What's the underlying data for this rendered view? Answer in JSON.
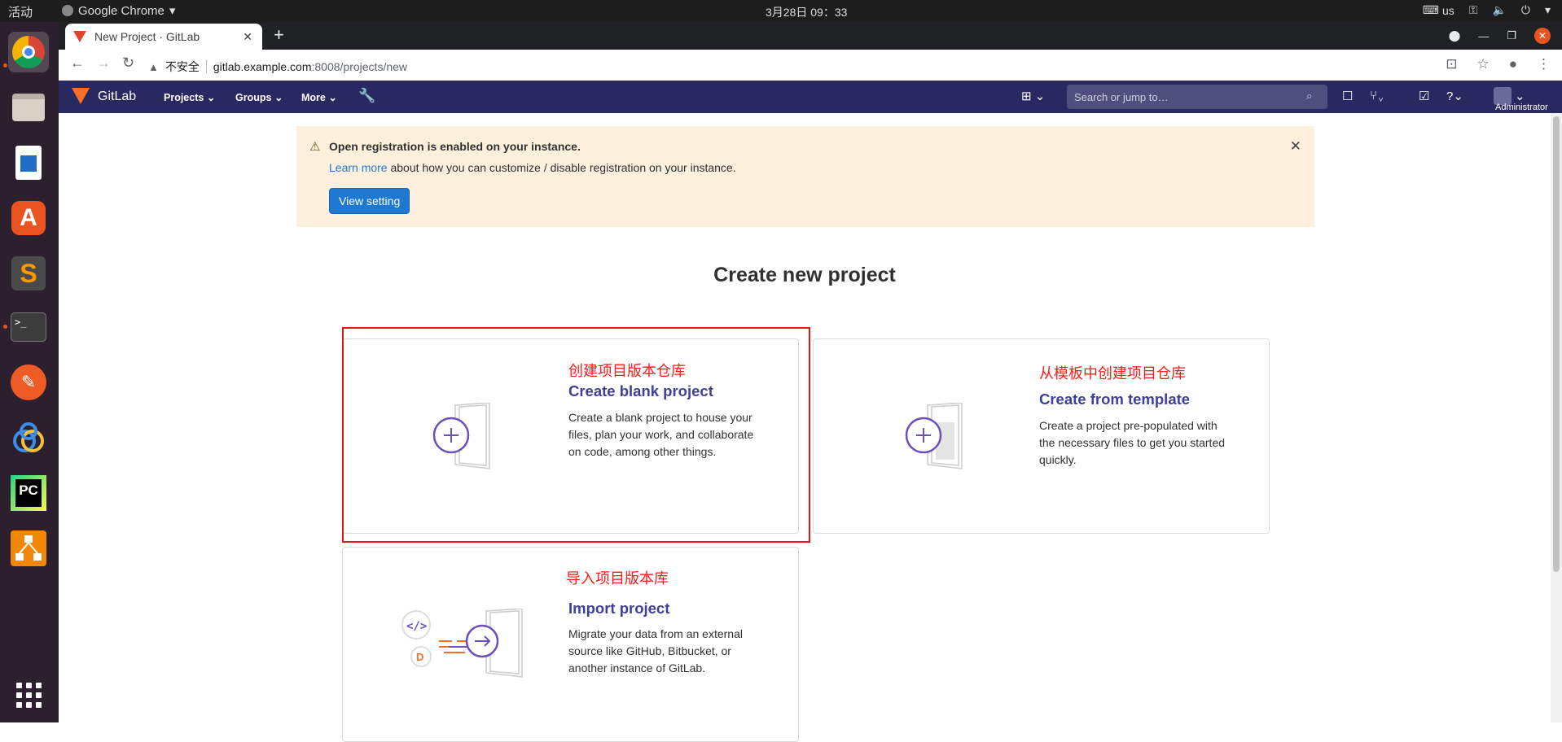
{
  "os": {
    "activities": "活动",
    "app_name": "Google Chrome",
    "clock": "3月28日  09：33",
    "input_method": "us"
  },
  "browser": {
    "tab_title": "New Project · GitLab",
    "security_label": "不安全",
    "url_host": "gitlab.example.com",
    "url_path": ":8008/projects/new"
  },
  "gitlab_nav": {
    "brand": "GitLab",
    "menus": [
      "Projects",
      "Groups",
      "More"
    ],
    "search_placeholder": "Search or jump to…",
    "user_label": "Administrator"
  },
  "alert": {
    "title": "Open registration is enabled on your instance.",
    "link_text": "Learn more",
    "body_text": " about how you can customize / disable registration on your instance.",
    "button_label": "View setting"
  },
  "page_title": "Create new project",
  "cards": [
    {
      "annotation": "创建项目版本仓库",
      "title": "Create blank project",
      "description": "Create a blank project to house your files, plan your work, and collaborate on code, among other things."
    },
    {
      "annotation": "从模板中创建项目仓库",
      "title": "Create from template",
      "description": "Create a project pre-populated with the necessary files to get you started quickly."
    },
    {
      "annotation": "导入项目版本库",
      "title": "Import project",
      "description": "Migrate your data from an external source like GitHub, Bitbucket, or another instance of GitLab."
    }
  ],
  "colors": {
    "gitlab_nav_bg": "#292961",
    "card_title": "#3f3f9a",
    "annotation_red": "#e61515",
    "alert_bg": "#fdf1dd",
    "primary_button": "#1f78d1"
  }
}
